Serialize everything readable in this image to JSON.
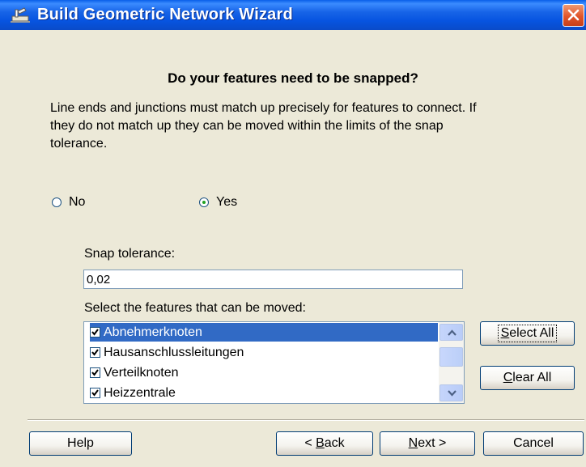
{
  "window": {
    "title": "Build Geometric Network Wizard",
    "icon": "network-wizard-icon",
    "close_icon": "close-icon"
  },
  "heading": "Do your features need to be snapped?",
  "description": "Line ends and junctions must match up precisely for features to connect.  If they do not match up they can be moved within the limits of the snap tolerance.",
  "snap_option": {
    "no_label": "No",
    "yes_label": "Yes",
    "selected": "Yes"
  },
  "snap_tolerance": {
    "label": "Snap tolerance:",
    "value": "0,02"
  },
  "features": {
    "label": "Select the features that can be moved:",
    "items": [
      {
        "label": "Abnehmerknoten",
        "checked": true,
        "selected": true
      },
      {
        "label": "Hausanschlussleitungen",
        "checked": true,
        "selected": false
      },
      {
        "label": "Verteilknoten",
        "checked": true,
        "selected": false
      },
      {
        "label": "Heizzentrale",
        "checked": true,
        "selected": false
      }
    ]
  },
  "buttons": {
    "select_all": {
      "pre": "",
      "mnemonic": "S",
      "post": "elect All"
    },
    "clear_all": {
      "pre": "",
      "mnemonic": "C",
      "post": "lear All"
    },
    "help": "Help",
    "back": {
      "pre": "< ",
      "mnemonic": "B",
      "post": "ack"
    },
    "next": {
      "pre": "",
      "mnemonic": "N",
      "post": "ext >"
    },
    "cancel": "Cancel"
  },
  "colors": {
    "titlebar": "#0A5FE8",
    "dialog_bg": "#ECE9D8",
    "selection": "#316AC5",
    "radio_dot": "#21A121"
  }
}
